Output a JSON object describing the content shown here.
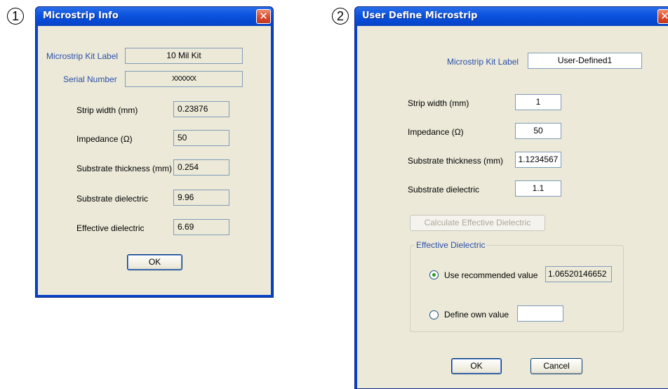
{
  "badges": {
    "first": "1",
    "second": "2"
  },
  "microstrip_info": {
    "title": "Microstrip Info",
    "kit_label_caption": "Microstrip Kit Label",
    "kit_label_value": "10 Mil Kit",
    "serial_caption": "Serial Number",
    "serial_value": "XXXXXX",
    "strip_width_caption": "Strip width (mm)",
    "strip_width_value": "0.23876",
    "impedance_caption": "Impedance (Ω)",
    "impedance_value": "50",
    "substrate_thickness_caption": "Substrate thickness (mm)",
    "substrate_thickness_value": "0.254",
    "substrate_dielectric_caption": "Substrate dielectric",
    "substrate_dielectric_value": "9.96",
    "effective_dielectric_caption": "Effective dielectric",
    "effective_dielectric_value": "6.69",
    "ok_label": "OK"
  },
  "user_define": {
    "title": "User Define Microstrip",
    "kit_label_caption": "Microstrip Kit Label",
    "kit_label_value": "User-Defined1",
    "strip_width_caption": "Strip width (mm)",
    "strip_width_value": "1",
    "impedance_caption": "Impedance (Ω)",
    "impedance_value": "50",
    "substrate_thickness_caption": "Substrate thickness (mm)",
    "substrate_thickness_value": "1.1234567",
    "substrate_dielectric_caption": "Substrate dielectric",
    "substrate_dielectric_value": "1.1",
    "calculate_label": "Calculate Effective Dielectric",
    "group_label": "Effective Dielectric",
    "use_recommended_label": "Use recommended value",
    "recommended_value": "1.06520146652",
    "define_own_label": "Define own value",
    "own_value": "",
    "selected_option": "use_recommended",
    "ok_label": "OK",
    "cancel_label": "Cancel"
  },
  "colors": {
    "title_bar": "#0c55e0",
    "dialog_face": "#ece9d8",
    "label_blue": "#2b4fa8",
    "close_button": "#d8462a"
  },
  "icons": [
    "close-icon",
    "radio-selected-icon",
    "radio-empty-icon"
  ]
}
